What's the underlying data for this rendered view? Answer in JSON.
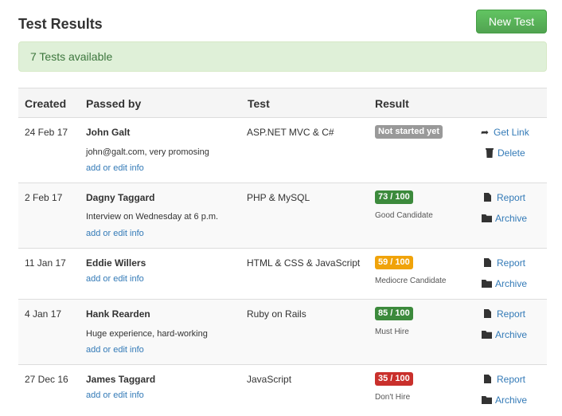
{
  "header": {
    "title": "Test Results",
    "new_test_label": "New Test"
  },
  "alert": {
    "text": "7 Tests available"
  },
  "table": {
    "columns": [
      "Created",
      "Passed by",
      "Test",
      "Result"
    ],
    "rows": [
      {
        "created": "24 Feb 17",
        "name": "John Galt",
        "note": "john@galt.com, very promosing",
        "edit_label": "add or edit info",
        "test": "ASP.NET MVC & C#",
        "result": "Not started yet",
        "result_color": "#999999",
        "verdict": "",
        "action1": "Get Link",
        "action2": "Delete"
      },
      {
        "created": "2 Feb 17",
        "name": "Dagny Taggard",
        "note": "Interview on Wednesday at 6 p.m.",
        "edit_label": "add or edit info",
        "test": "PHP & MySQL",
        "result": "73 / 100",
        "result_color": "#3c8a3c",
        "verdict": "Good Candidate",
        "action1": "Report",
        "action2": "Archive"
      },
      {
        "created": "11 Jan 17",
        "name": "Eddie Willers",
        "note": "",
        "edit_label": "add or edit info",
        "test": "HTML & CSS & JavaScript",
        "result": "59 / 100",
        "result_color": "#f0a30a",
        "verdict": "Mediocre Candidate",
        "action1": "Report",
        "action2": "Archive"
      },
      {
        "created": "4 Jan 17",
        "name": "Hank Rearden",
        "note": "Huge experience, hard-working",
        "edit_label": "add or edit info",
        "test": "Ruby on Rails",
        "result": "85 / 100",
        "result_color": "#3c8a3c",
        "verdict": "Must Hire",
        "action1": "Report",
        "action2": "Archive"
      },
      {
        "created": "27 Dec 16",
        "name": "James Taggard",
        "note": "",
        "edit_label": "add or edit info",
        "test": "JavaScript",
        "result": "35 / 100",
        "result_color": "#c9302c",
        "verdict": "Don't Hire",
        "action1": "Report",
        "action2": "Archive"
      }
    ]
  }
}
